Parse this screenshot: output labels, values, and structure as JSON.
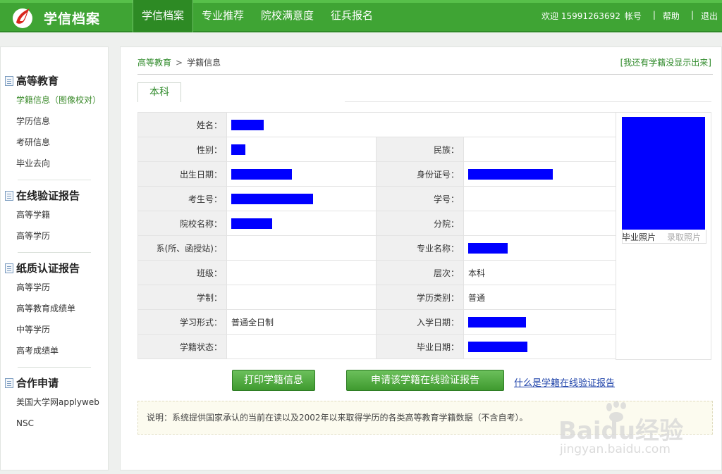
{
  "header": {
    "logo_icon": "flame-logo-icon",
    "title": "学信档案",
    "nav": [
      "学信档案",
      "专业推荐",
      "院校满意度",
      "征兵报名"
    ],
    "welcome": "欢迎 15991263692",
    "account": "帐号",
    "help": "帮助",
    "logout": "退出"
  },
  "sidebar": {
    "groups": [
      {
        "title": "高等教育",
        "items": [
          "学籍信息（图像校对）",
          "学历信息",
          "考研信息",
          "毕业去向"
        ]
      },
      {
        "title": "在线验证报告",
        "items": [
          "高等学籍",
          "高等学历"
        ]
      },
      {
        "title": "纸质认证报告",
        "items": [
          "高等学历",
          "高等教育成绩单",
          "中等学历",
          "高考成绩单"
        ]
      },
      {
        "title": "合作申请",
        "items": [
          "美国大学网applyweb",
          "NSC"
        ]
      }
    ]
  },
  "main": {
    "breadcrumb": {
      "root": "高等教育",
      "arrow": ">",
      "current": "学籍信息"
    },
    "missing_link": "[我还有学籍没显示出来]",
    "tab": "本科",
    "fields": {
      "name": {
        "label": "姓名："
      },
      "gender": {
        "label": "性别："
      },
      "ethnicity": {
        "label": "民族：",
        "value": ""
      },
      "birth": {
        "label": "出生日期："
      },
      "id_number": {
        "label": "身份证号："
      },
      "exam_no": {
        "label": "考生号："
      },
      "student_no": {
        "label": "学号：",
        "value": ""
      },
      "school": {
        "label": "院校名称："
      },
      "branch": {
        "label": "分院：",
        "value": ""
      },
      "department": {
        "label": "系(所、函授站)：",
        "value": ""
      },
      "major": {
        "label": "专业名称："
      },
      "class": {
        "label": "班级：",
        "value": ""
      },
      "level": {
        "label": "层次：",
        "value": "本科"
      },
      "duration": {
        "label": "学制：",
        "value": ""
      },
      "category": {
        "label": "学历类别：",
        "value": "普通"
      },
      "study_form": {
        "label": "学习形式：",
        "value": "普通全日制"
      },
      "enroll_date": {
        "label": "入学日期："
      },
      "status": {
        "label": "学籍状态：",
        "value": ""
      },
      "grad_date": {
        "label": "毕业日期："
      }
    },
    "photo": {
      "tab_grad": "毕业照片",
      "tab_enroll": "录取照片"
    },
    "buttons": {
      "print": "打印学籍信息",
      "apply": "申请该学籍在线验证报告"
    },
    "help_link": "什么是学籍在线验证报告",
    "notice": "说明：系统提供国家承认的当前在读以及2002年以来取得学历的各类高等教育学籍数据（不含自考）。"
  },
  "watermark": {
    "brand": "Baidu经验",
    "url": "jingyan.baidu.com"
  },
  "colors": {
    "header_green": "#3fa434",
    "redaction_blue": "#0000ff",
    "link_green": "#2f8a2a"
  }
}
